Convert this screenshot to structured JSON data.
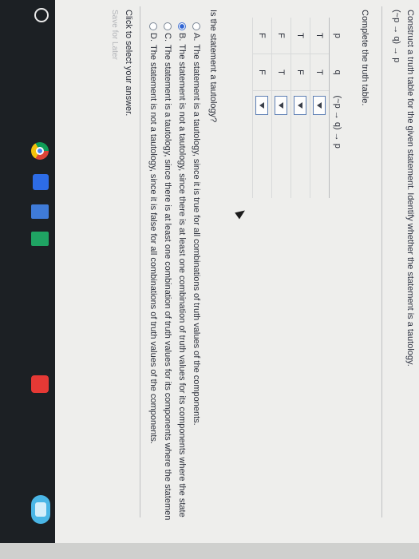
{
  "question": {
    "instruction": "Construct a truth table for the given statement. Identify whether the statement is a tautology.",
    "expression": "(~p → q) → p"
  },
  "truth_table": {
    "label": "Complete the truth table.",
    "headers": [
      "p",
      "q",
      "(~p → q) → p"
    ],
    "rows": [
      {
        "p": "T",
        "q": "T"
      },
      {
        "p": "T",
        "q": "F"
      },
      {
        "p": "F",
        "q": "T"
      },
      {
        "p": "F",
        "q": "F"
      }
    ]
  },
  "tautology": {
    "question": "Is the statement a tautology?",
    "options": [
      {
        "letter": "A.",
        "text": "The statement is a tautology, since it is true for all combinations of truth values of the components.",
        "selected": false
      },
      {
        "letter": "B.",
        "text": "The statement is not a tautology, since there is at least one combination of truth values for its components where the state",
        "selected": true
      },
      {
        "letter": "C.",
        "text": "The statement is a tautology, since there is at least one combination of truth values for its components where the statemen",
        "selected": false
      },
      {
        "letter": "D.",
        "text": "The statement is not a tautology, since it is false for all combinations of truth values of the components.",
        "selected": false
      }
    ]
  },
  "footer": {
    "click_hint": "Click to select your answer.",
    "save_later": "Save for Later"
  },
  "shelf": {
    "icons": [
      "launcher-icon",
      "chrome-icon",
      "files-icon",
      "docs-icon",
      "sheets-icon",
      "play-icon",
      "status-area"
    ]
  },
  "colors": {
    "screen_bg": "#eeeeec",
    "shelf_bg": "#1c2024",
    "select_border": "#5d7fb4",
    "radio_selected": "#2f64d3"
  }
}
